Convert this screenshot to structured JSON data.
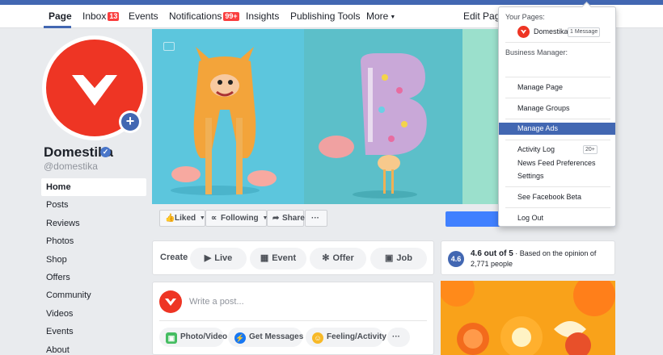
{
  "nav": {
    "page": "Page",
    "inbox": "Inbox",
    "inbox_badge": "13",
    "events": "Events",
    "notifications": "Notifications",
    "notifications_badge": "99+",
    "insights": "Insights",
    "publishing_tools": "Publishing Tools",
    "more": "More",
    "edit_page": "Edit Page"
  },
  "profile": {
    "name": "Domestika",
    "handle": "@domestika",
    "brand_color": "#ee3524"
  },
  "sidebar": {
    "items": [
      "Home",
      "Posts",
      "Reviews",
      "Photos",
      "Shop",
      "Offers",
      "Community",
      "Videos",
      "Events",
      "About"
    ]
  },
  "actions": {
    "liked": "Liked",
    "following": "Following",
    "share": "Share",
    "more": "···"
  },
  "create": {
    "label": "Create",
    "live": "Live",
    "event": "Event",
    "offer": "Offer",
    "job": "Job"
  },
  "composer": {
    "placeholder": "Write a post...",
    "photo_video": "Photo/Video",
    "get_messages": "Get Messages",
    "feeling": "Feeling/Activity",
    "more": "···"
  },
  "rating": {
    "badge": "4.6",
    "score": "4.6 out of 5",
    "detail": " · Based on the opinion of 2,771 people"
  },
  "dropdown": {
    "your_pages": "Your Pages:",
    "page_name": "Domestika",
    "page_messages": "1 Message",
    "business_manager": "Business Manager:",
    "manage_page": "Manage Page",
    "manage_groups": "Manage Groups",
    "manage_ads": "Manage Ads",
    "activity_log": "Activity Log",
    "activity_count": "20+",
    "news_feed_prefs": "News Feed Preferences",
    "settings": "Settings",
    "see_beta": "See Facebook Beta",
    "log_out": "Log Out"
  }
}
